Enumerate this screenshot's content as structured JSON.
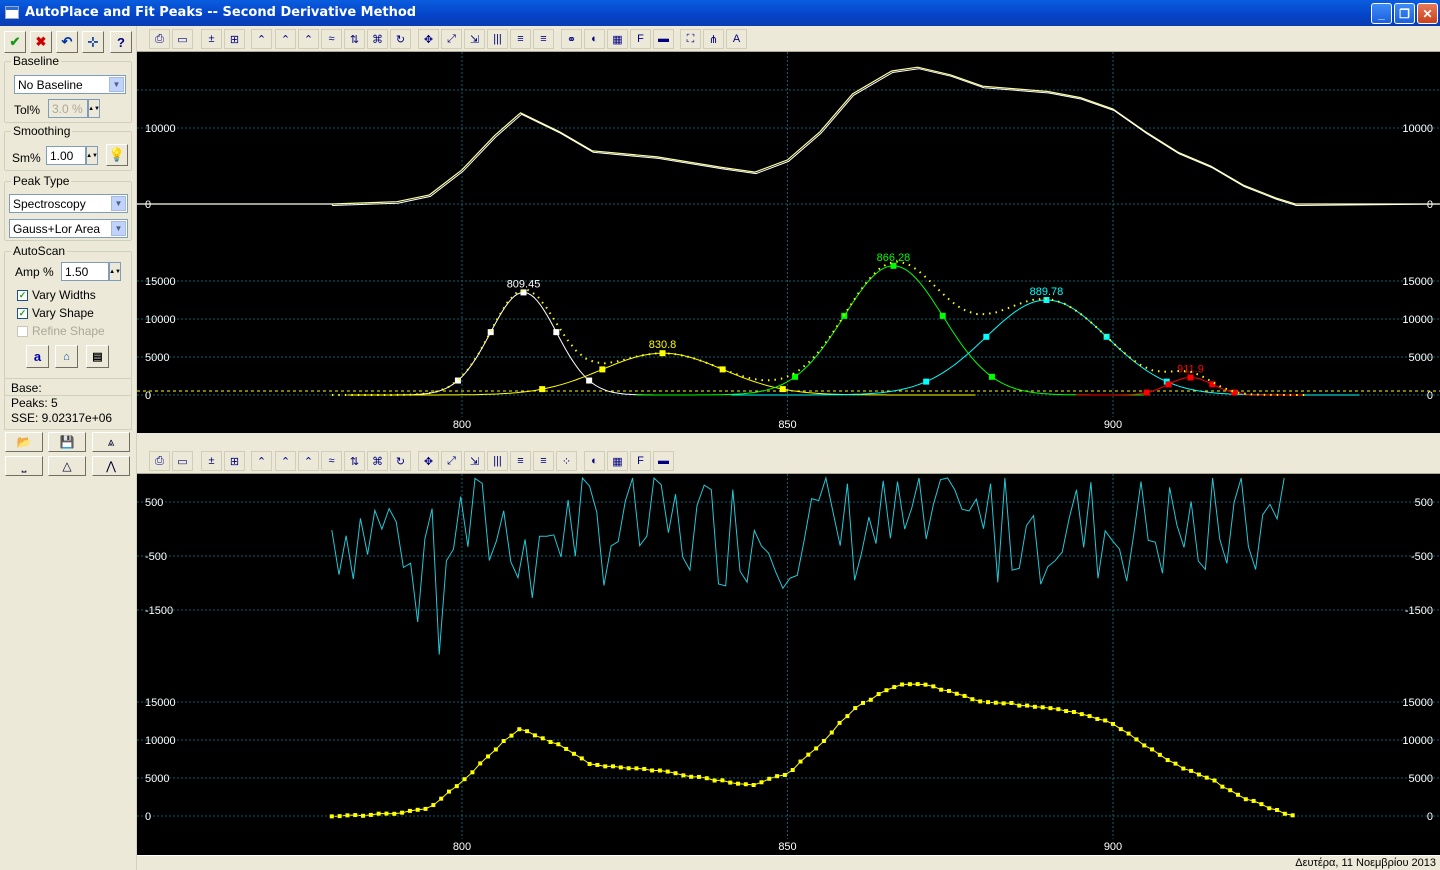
{
  "window": {
    "title": "AutoPlace and Fit Peaks -- Second Derivative Method"
  },
  "icons": {
    "accept": "check-icon",
    "reject": "x-icon",
    "undo": "undo-icon",
    "place": "peak-place-icon",
    "help": "help-icon"
  },
  "baseline": {
    "title": "Baseline",
    "option": "No Baseline",
    "tol_label": "Tol%",
    "tol_value": "3.0 %"
  },
  "smoothing": {
    "title": "Smoothing",
    "sm_label": "Sm%",
    "sm_value": "1.00"
  },
  "peak_type": {
    "title": "Peak Type",
    "option1": "Spectroscopy",
    "option2": "Gauss+Lor Area"
  },
  "autoscan": {
    "title": "AutoScan",
    "amp_label": "Amp %",
    "amp_value": "1.50",
    "vary_widths": "Vary Widths",
    "vary_shape": "Vary Shape",
    "refine_shape": "Refine Shape",
    "btn_a": "a"
  },
  "stats": {
    "base": "Base:",
    "peaks": "Peaks:  5",
    "sse": "SSE:  9.02317e+06"
  },
  "status": {
    "date": "Δευτέρα, 11 Νοεμβρίου 2013"
  },
  "chart_data": [
    {
      "type": "line",
      "name": "data-vs-fit",
      "x_range": [
        770,
        1000
      ],
      "y_ticks_left": [
        "10000",
        "0"
      ],
      "y_ticks_right": [
        "10000",
        "0"
      ],
      "ylim": [
        0,
        18000
      ],
      "series_data": [
        [
          780,
          0
        ],
        [
          790,
          300
        ],
        [
          795,
          1200
        ],
        [
          800,
          4500
        ],
        [
          805,
          9000
        ],
        [
          809,
          12000
        ],
        [
          815,
          9500
        ],
        [
          820,
          7000
        ],
        [
          830,
          6200
        ],
        [
          840,
          4800
        ],
        [
          845,
          4200
        ],
        [
          850,
          5800
        ],
        [
          855,
          9500
        ],
        [
          860,
          14500
        ],
        [
          866,
          17500
        ],
        [
          870,
          18000
        ],
        [
          875,
          17000
        ],
        [
          880,
          15500
        ],
        [
          890,
          14800
        ],
        [
          895,
          14000
        ],
        [
          900,
          12500
        ],
        [
          905,
          9500
        ],
        [
          910,
          6800
        ],
        [
          915,
          5000
        ],
        [
          920,
          2500
        ],
        [
          925,
          800
        ],
        [
          928,
          0
        ]
      ]
    },
    {
      "type": "line",
      "name": "peaks",
      "x_ticks": [
        "800",
        "850",
        "900"
      ],
      "y_ticks_left": [
        "15000",
        "10000",
        "5000",
        "0"
      ],
      "y_ticks_right": [
        "15000",
        "10000",
        "5000",
        "0"
      ],
      "ylim": [
        -1000,
        17500
      ],
      "peaks": [
        {
          "center": 809.45,
          "label": "809.45",
          "height": 13500,
          "width": 12,
          "color": "#ffffff"
        },
        {
          "center": 830.8,
          "label": "830.8",
          "height": 5500,
          "width": 22,
          "color": "#ffff00"
        },
        {
          "center": 866.28,
          "label": "866.28",
          "height": 17000,
          "width": 18,
          "color": "#00ff00"
        },
        {
          "center": 889.78,
          "label": "889.78",
          "height": 12500,
          "width": 22,
          "color": "#00ffff"
        },
        {
          "center": 911.9,
          "label": "911.9",
          "height": 2300,
          "width": 8,
          "color": "#ff0000"
        }
      ]
    },
    {
      "type": "line",
      "name": "residuals",
      "y_ticks_left": [
        "500",
        "-500",
        "-1500"
      ],
      "y_ticks_right": [
        "500",
        "-500",
        "-1500"
      ],
      "ylim": [
        -2000,
        1000
      ]
    },
    {
      "type": "scatter",
      "name": "raw-data",
      "x_ticks": [
        "800",
        "850",
        "900"
      ],
      "y_ticks_left": [
        "15000",
        "10000",
        "5000",
        "0"
      ],
      "y_ticks_right": [
        "15000",
        "10000",
        "5000",
        "0"
      ],
      "ylim": [
        -1000,
        18000
      ]
    }
  ]
}
